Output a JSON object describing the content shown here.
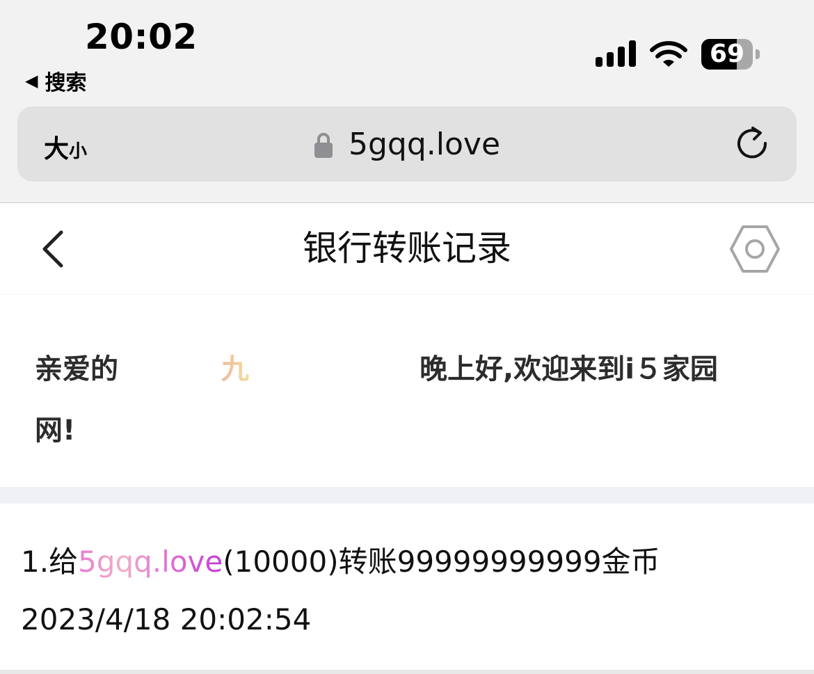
{
  "status_bar": {
    "time": "20:02",
    "back_app_label": "搜索",
    "signal_bars": 4,
    "battery_level": "69",
    "battery_fraction": 0.69
  },
  "browser": {
    "text_size_big": "大",
    "text_size_small": "小",
    "url": "5gqq.love",
    "icons": [
      "lock-icon",
      "reload-icon"
    ]
  },
  "header": {
    "title": "银行转账记录",
    "icons": [
      "back-chevron-icon",
      "settings-hexagon-icon"
    ]
  },
  "welcome": {
    "prefix": "亲爱的",
    "name": "九",
    "suffix": "晚上好,欢迎来到i５家园",
    "line2": "网!"
  },
  "record": {
    "index": "1.",
    "give": "给",
    "recipient": "5gqq.love",
    "details": "(10000)转账99999999999金币",
    "timestamp": "2023/4/18 20:02:54"
  },
  "colors": {
    "chrome_bg": "#f2f2f2",
    "urlbar_bg": "#e1e1e1",
    "section_gap": "#f0f1f5",
    "name_gradient": [
      "#f0b79a",
      "#f3dd9c"
    ],
    "domain_gradient": [
      "#e77ad4",
      "#f2b1c5",
      "#c43bd8"
    ]
  }
}
